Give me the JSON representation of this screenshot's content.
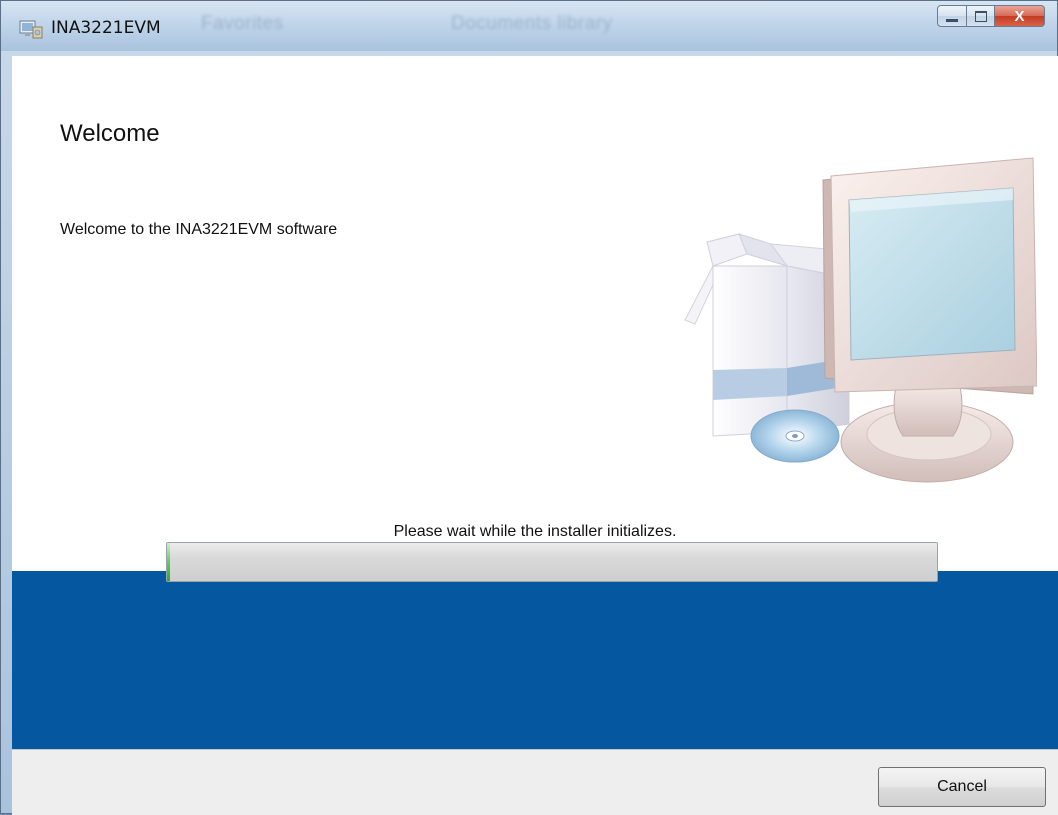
{
  "window": {
    "title": "INA3221EVM",
    "background_text": [
      "Favorites",
      "Documents library"
    ],
    "controls": {
      "close_glyph": "X"
    }
  },
  "main": {
    "heading": "Welcome",
    "message": "Welcome to the INA3221EVM software",
    "status": "Please wait while the installer initializes.",
    "progress_fraction": 0.0,
    "illustration": "computer-installer-illustration"
  },
  "footer": {
    "cancel_label": "Cancel"
  },
  "colors": {
    "panel_blue": "#0558a0",
    "content_bg": "#ffffff",
    "footer_bg": "#eeeeee",
    "progress_track": "#d9d9d9",
    "progress_fill": "#5ccf5c"
  },
  "icons": [
    "installer-app-icon",
    "minimize-icon",
    "maximize-icon",
    "close-icon"
  ]
}
